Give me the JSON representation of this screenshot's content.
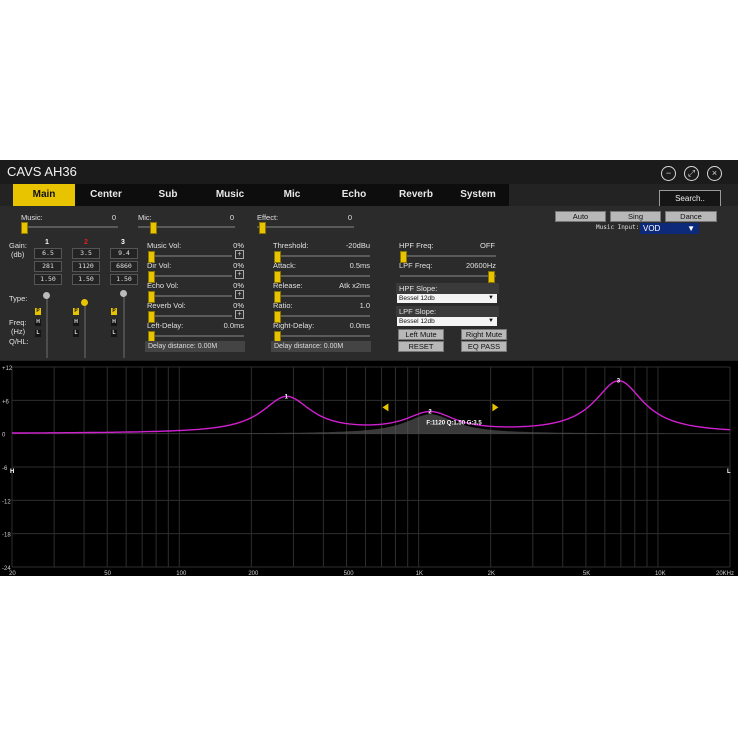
{
  "app": {
    "title": "CAVS AH36"
  },
  "window_buttons": {
    "minimize": "−",
    "maximize": "⤢",
    "close": "×"
  },
  "tabs": [
    "Main",
    "Center",
    "Sub",
    "Music",
    "Mic",
    "Echo",
    "Reverb",
    "System"
  ],
  "search_label": "Search..",
  "mix": {
    "music": {
      "label": "Music:",
      "value": "0"
    },
    "mic": {
      "label": "Mic:",
      "value": "0"
    },
    "effect": {
      "label": "Effect:",
      "value": "0"
    }
  },
  "modes": {
    "auto": "Auto",
    "sing": "Sing",
    "dance": "Dance"
  },
  "music_input": {
    "label": "Music Input:",
    "value": "VOD"
  },
  "eq_bands": {
    "gain_label": "Gain:",
    "db_label": "(db)",
    "type_label": "Type:",
    "freq_label": "Freq:",
    "hz_label": "(Hz)",
    "qhl_label": "Q/HL:",
    "bands": [
      {
        "num": "1",
        "gain": "6.5",
        "freq": "281",
        "q": "1.50"
      },
      {
        "num": "2",
        "gain": "3.5",
        "freq": "1120",
        "q": "1.50"
      },
      {
        "num": "3",
        "gain": "9.4",
        "freq": "6860",
        "q": "1.50"
      }
    ],
    "type_p": "P",
    "type_h": "H",
    "type_l": "L"
  },
  "vols": {
    "music_vol": {
      "label": "Music Vol:",
      "value": "0%"
    },
    "dir_vol": {
      "label": "Dir Vol:",
      "value": "0%"
    },
    "echo_vol": {
      "label": "Echo Vol:",
      "value": "0%"
    },
    "reverb_vol": {
      "label": "Reverb Vol:",
      "value": "0%"
    },
    "left_delay": {
      "label": "Left-Delay:",
      "value": "0.0ms"
    },
    "left_distance": "Delay distance: 0.00M"
  },
  "compressor": {
    "threshold": {
      "label": "Threshold:",
      "value": "-20dBu"
    },
    "attack": {
      "label": "Attack:",
      "value": "0.5ms"
    },
    "release": {
      "label": "Release:",
      "value": "Atk x2ms"
    },
    "ratio": {
      "label": "Ratio:",
      "value": "1.0"
    },
    "right_delay": {
      "label": "Right-Delay:",
      "value": "0.0ms"
    },
    "right_distance": "Delay distance: 0.00M"
  },
  "filters": {
    "hpf_freq": {
      "label": "HPF Freq:",
      "value": "OFF"
    },
    "lpf_freq": {
      "label": "LPF Freq:",
      "value": "20600Hz"
    },
    "hpf_slope": {
      "label": "HPF Slope:",
      "value": "Bessel 12db"
    },
    "lpf_slope": {
      "label": "LPF Slope:",
      "value": "Bessel 12db"
    }
  },
  "buttons": {
    "left_mute": "Left Mute",
    "right_mute": "Right Mute",
    "reset": "RESET",
    "eq_pass": "EQ PASS"
  },
  "colors": {
    "accent": "#e8c400",
    "curve": "#d020d0",
    "select_bg": "#0d2a7a"
  },
  "graph": {
    "y_ticks": [
      "+12",
      "+6",
      "0",
      "-6",
      "-12",
      "-18",
      "-24"
    ],
    "x_ticks": [
      "20",
      "50",
      "100",
      "200",
      "500",
      "1K",
      "2K",
      "5K",
      "10K",
      "20KHz"
    ],
    "h_marker": "H",
    "l_marker": "L",
    "selected_info": "F:1120 Q:1.50 G:3.5"
  },
  "chart_data": {
    "type": "line",
    "xscale": "log",
    "xlim": [
      20,
      20000
    ],
    "ylim": [
      -24,
      12
    ],
    "grid": true,
    "bands": [
      {
        "label": "1",
        "freq": 281,
        "gain": 6.5,
        "q": 1.5
      },
      {
        "label": "2",
        "freq": 1120,
        "gain": 3.5,
        "q": 1.5
      },
      {
        "label": "3",
        "freq": 6860,
        "gain": 9.4,
        "q": 1.5
      }
    ]
  }
}
